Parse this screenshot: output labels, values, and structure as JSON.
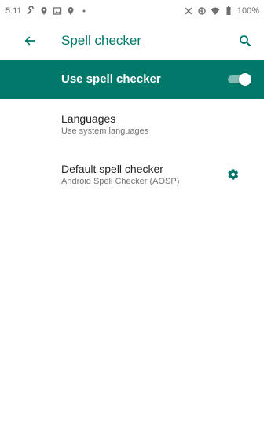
{
  "status_bar": {
    "time": "5:11",
    "battery": "100%",
    "icons_left": [
      "wrench-icon",
      "location-icon",
      "image-icon",
      "location-icon",
      "dot-icon"
    ],
    "icons_right": [
      "vibrate-icon",
      "data-saver-icon",
      "wifi-icon",
      "battery-icon"
    ]
  },
  "app_bar": {
    "title": "Spell checker",
    "back_icon": "back-arrow-icon",
    "search_icon": "search-icon"
  },
  "master_switch": {
    "label": "Use spell checker",
    "enabled": true
  },
  "preferences": [
    {
      "title": "Languages",
      "summary": "Use system languages"
    },
    {
      "title": "Default spell checker",
      "summary": "Android Spell Checker (AOSP)",
      "action_icon": "gear-icon"
    }
  ],
  "colors": {
    "accent": "#00796b",
    "text_primary": "#202124",
    "text_secondary": "#757575"
  }
}
